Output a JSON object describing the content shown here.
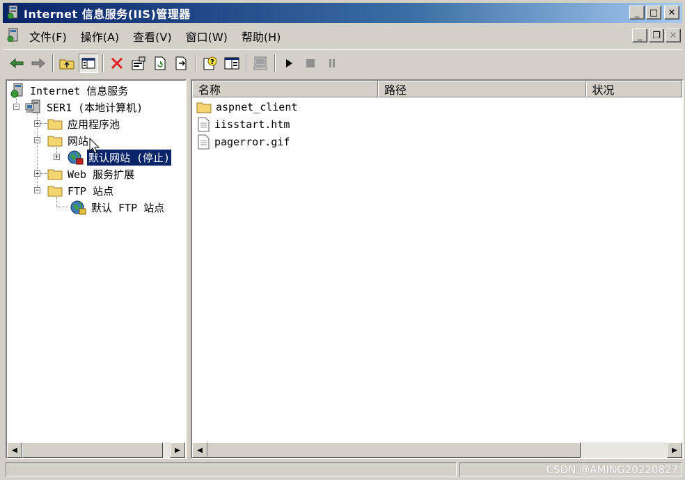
{
  "window": {
    "title": "Internet 信息服务(IIS)管理器",
    "buttons": {
      "minimize": "_",
      "maximize": "□",
      "close": "✕"
    }
  },
  "menu": {
    "items": [
      "文件(F)",
      "操作(A)",
      "查看(V)",
      "窗口(W)",
      "帮助(H)"
    ],
    "mdi_buttons": {
      "minimize": "_",
      "restore": "❐",
      "close": "✕"
    }
  },
  "toolbar": {
    "buttons": [
      "back-arrow-icon",
      "forward-arrow-icon",
      "up-folder-icon",
      "show-tree-icon",
      "delete-icon",
      "properties-icon",
      "refresh-icon",
      "export-list-icon",
      "help-icon",
      "console-window-icon",
      "computer-icon",
      "start-icon",
      "stop-icon",
      "pause-icon"
    ]
  },
  "tree": {
    "root": "Internet 信息服务",
    "server": "SER1 (本地计算机)",
    "app_pools": "应用程序池",
    "websites": "网站",
    "default_site": "默认网站 (停止)",
    "web_ext": "Web 服务扩展",
    "ftp_sites": "FTP 站点",
    "default_ftp": "默认 FTP 站点"
  },
  "list": {
    "columns": [
      "名称",
      "路径",
      "状况"
    ],
    "rows": [
      {
        "name": "aspnet_client",
        "icon": "folder-icon"
      },
      {
        "name": "iisstart.htm",
        "icon": "document-icon"
      },
      {
        "name": "pagerror.gif",
        "icon": "document-icon"
      }
    ]
  },
  "statusbar": {
    "watermark": "CSDN @AMING20220827"
  },
  "colors": {
    "titlebar": "#0a246a",
    "selection": "#0a246a",
    "face": "#d4d0c8"
  }
}
